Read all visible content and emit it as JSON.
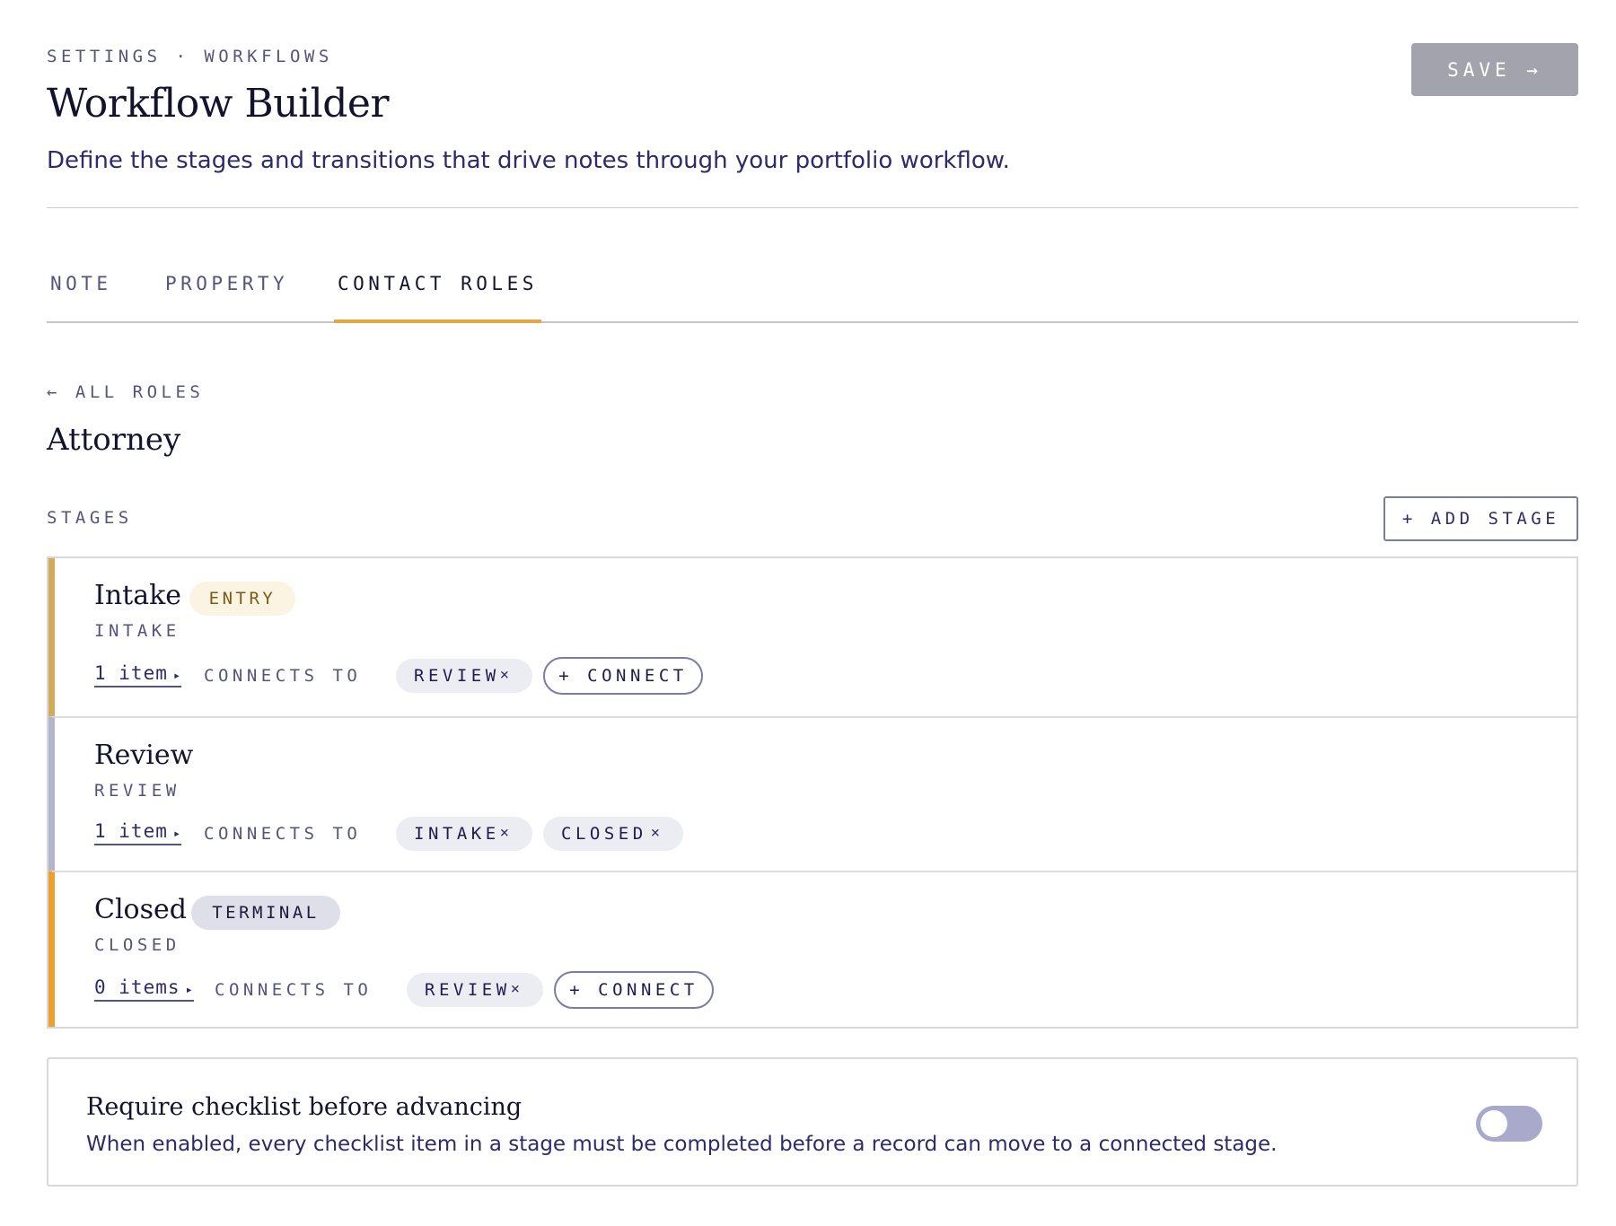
{
  "header": {
    "breadcrumb": "SETTINGS · WORKFLOWS",
    "title": "Workflow Builder",
    "subtitle": "Define the stages and transitions that drive notes through your portfolio workflow.",
    "save_label": "SAVE →"
  },
  "tabs": [
    {
      "label": "NOTE",
      "active": false
    },
    {
      "label": "PROPERTY",
      "active": false
    },
    {
      "label": "CONTACT ROLES",
      "active": true
    }
  ],
  "role": {
    "back_label": "← ALL ROLES",
    "name": "Attorney"
  },
  "stages_section": {
    "label": "STAGES",
    "add_label": "+ ADD STAGE",
    "connects_label": "CONNECTS TO",
    "connect_label": "+ CONNECT",
    "remove_glyph": "×",
    "expand_glyph": "▸"
  },
  "stages": [
    {
      "name": "Intake",
      "badge": "ENTRY",
      "key": "INTAKE",
      "items": "1 item",
      "connections": [
        "REVIEW"
      ],
      "accent": "#d4ab58"
    },
    {
      "name": "Review",
      "badge": "",
      "key": "REVIEW",
      "items": "1 item",
      "connections": [
        "INTAKE",
        "CLOSED"
      ],
      "accent": "#b4b4cc"
    },
    {
      "name": "Closed",
      "badge": "TERMINAL",
      "key": "CLOSED",
      "items": "0 items",
      "connections": [
        "REVIEW"
      ],
      "accent": "#eda12a"
    }
  ],
  "setting": {
    "title": "Require checklist before advancing",
    "description": "When enabled, every checklist item in a stage must be completed before a record can move to a connected stage.",
    "enabled": false
  },
  "colors": {
    "accent": "#e2a942",
    "primary_text": "#14132e",
    "muted_text": "#55547e"
  }
}
